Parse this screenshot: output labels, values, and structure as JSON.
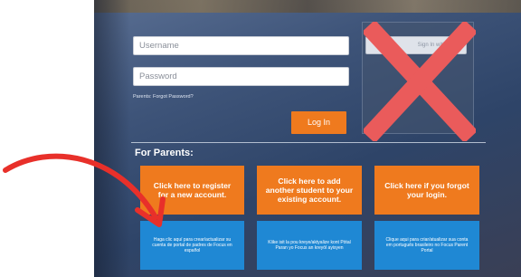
{
  "login": {
    "username_placeholder": "Username",
    "password_placeholder": "Password",
    "forgot_text": "Parents: Forgot Password?",
    "login_label": "Log In"
  },
  "right_panel": {
    "button_label": "Sign In with SSO"
  },
  "parents": {
    "title": "For Parents:",
    "orange_buttons": [
      {
        "label": "Click here to register for a new account."
      },
      {
        "label": "Click here to add another student to your existing account."
      },
      {
        "label": "Click here if you forgot your login."
      }
    ],
    "blue_buttons": [
      {
        "label": "Haga clic aquí para crear/actualizar su cuenta de portal de padres de Focus en español"
      },
      {
        "label": "Klike isit la pou kreye/aktyalize kont Pòtal Paran yo Focus an kreyòl ayisyen"
      },
      {
        "label": "Clique aqui para criar/atualizar sua conta em português brasileiro no Focus Parent Portal"
      }
    ]
  },
  "colors": {
    "orange": "#ef7a1e",
    "blue": "#1f88d4",
    "red_mark": "#ea5b5b",
    "arrow_red": "#e8302a"
  },
  "icons": {
    "cross": "x-mark-icon",
    "arrow": "curved-arrow-icon"
  }
}
